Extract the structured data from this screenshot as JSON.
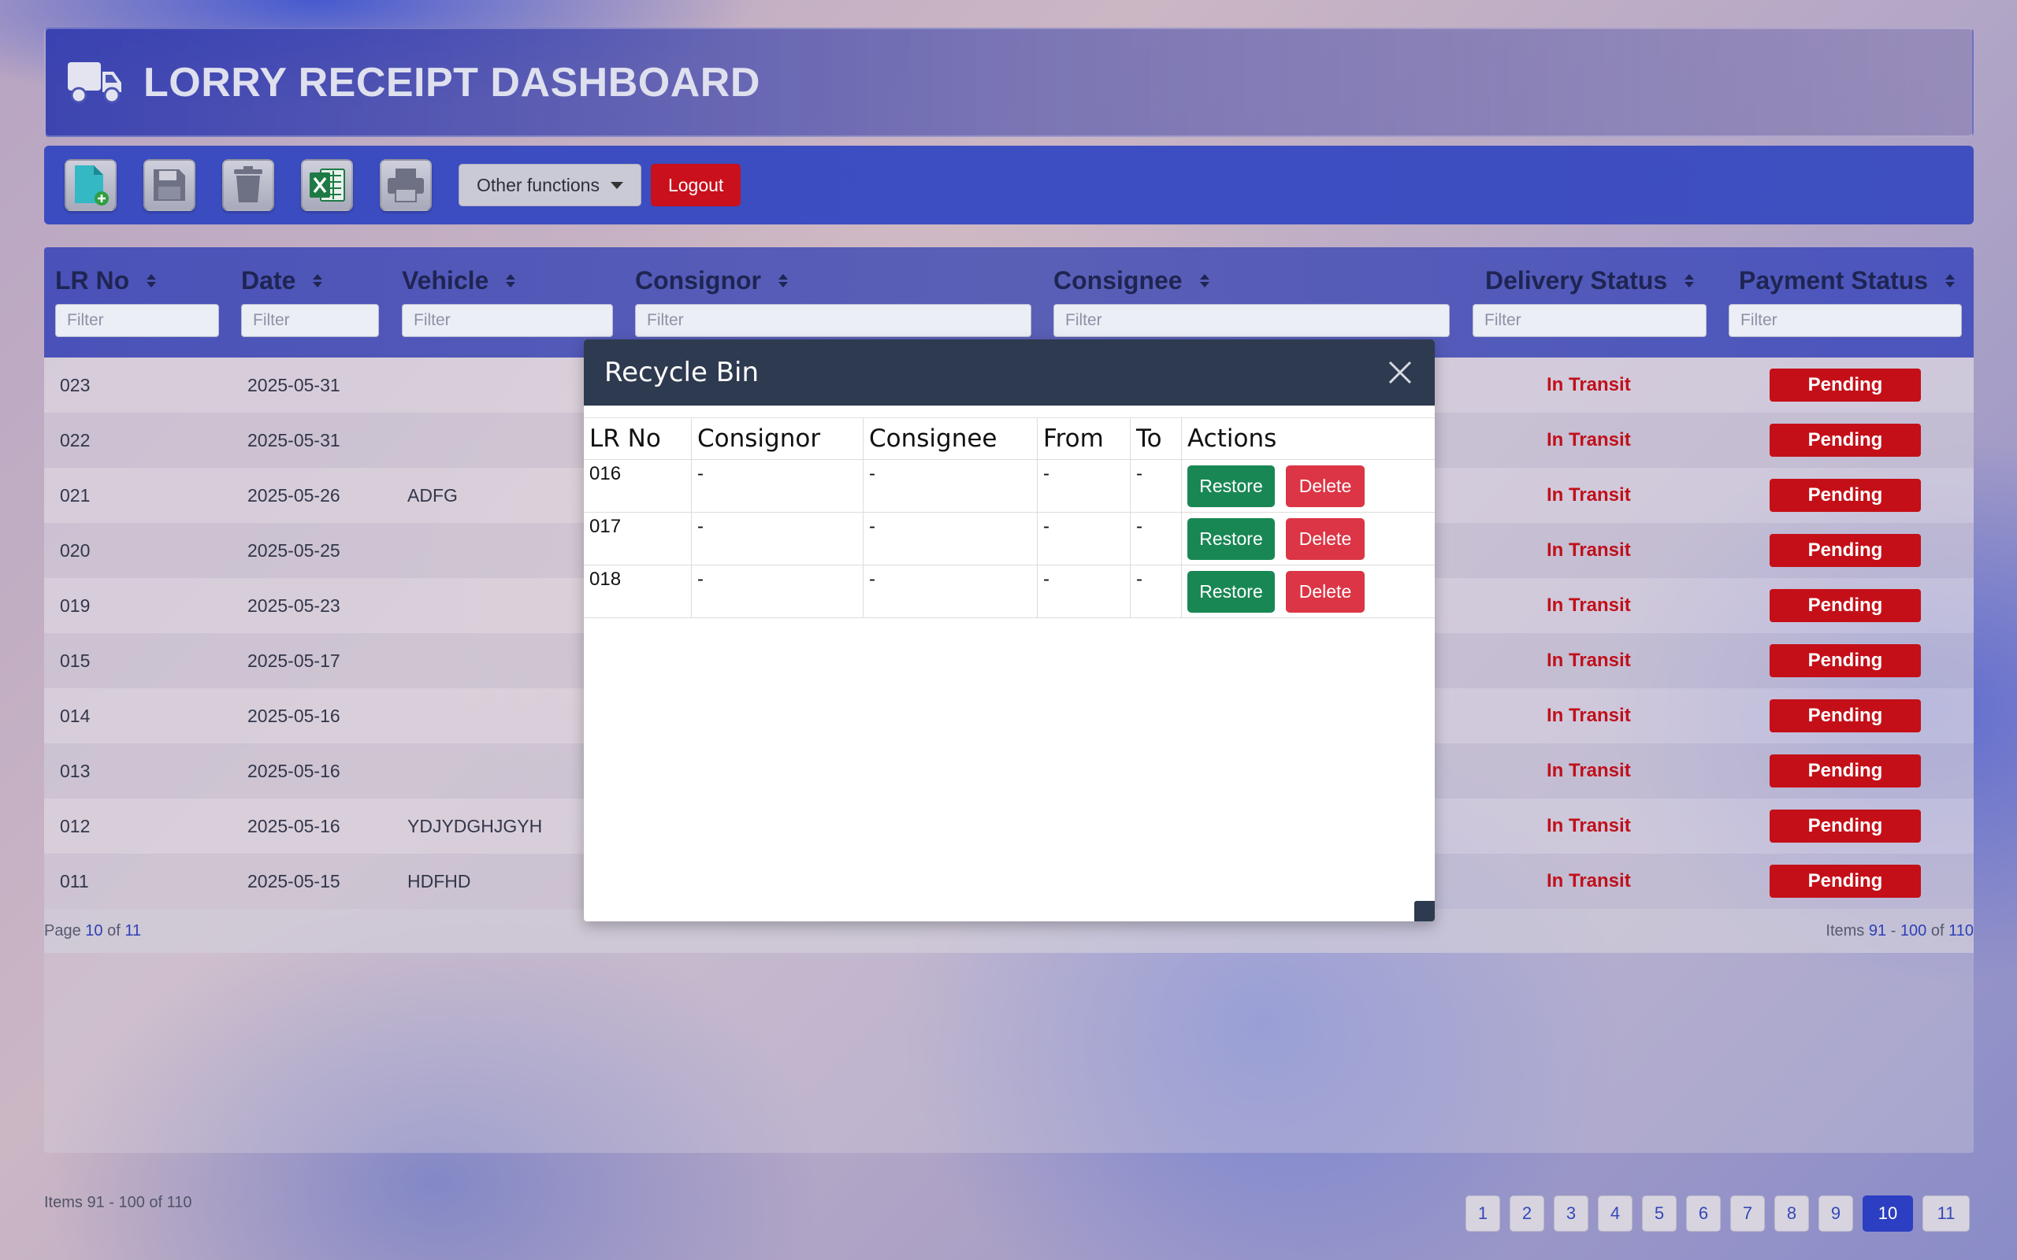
{
  "header": {
    "title": "LORRY RECEIPT DASHBOARD",
    "icon": "truck-icon"
  },
  "toolbar": {
    "buttons": [
      {
        "name": "new-document",
        "icon": "new-file-icon"
      },
      {
        "name": "save",
        "icon": "floppy-disk-icon"
      },
      {
        "name": "delete",
        "icon": "trash-icon"
      },
      {
        "name": "export-excel",
        "icon": "excel-icon"
      },
      {
        "name": "print",
        "icon": "printer-icon"
      }
    ],
    "other_functions_label": "Other functions",
    "logout_label": "Logout"
  },
  "grid": {
    "columns": [
      {
        "label": "LR No",
        "filter_placeholder": "Filter"
      },
      {
        "label": "Date",
        "filter_placeholder": "Filter"
      },
      {
        "label": "Vehicle",
        "filter_placeholder": "Filter"
      },
      {
        "label": "Consignor",
        "filter_placeholder": "Filter"
      },
      {
        "label": "Consignee",
        "filter_placeholder": "Filter"
      },
      {
        "label": "Delivery Status",
        "filter_placeholder": "Filter"
      },
      {
        "label": "Payment Status",
        "filter_placeholder": "Filter"
      }
    ],
    "rows": [
      {
        "lr_no": "023",
        "date": "2025-05-31",
        "vehicle": "",
        "delivery_status": "In Transit",
        "payment_status": "Pending"
      },
      {
        "lr_no": "022",
        "date": "2025-05-31",
        "vehicle": "",
        "delivery_status": "In Transit",
        "payment_status": "Pending"
      },
      {
        "lr_no": "021",
        "date": "2025-05-26",
        "vehicle": "ADFG",
        "delivery_status": "In Transit",
        "payment_status": "Pending"
      },
      {
        "lr_no": "020",
        "date": "2025-05-25",
        "vehicle": "",
        "delivery_status": "In Transit",
        "payment_status": "Pending"
      },
      {
        "lr_no": "019",
        "date": "2025-05-23",
        "vehicle": "",
        "delivery_status": "In Transit",
        "payment_status": "Pending"
      },
      {
        "lr_no": "015",
        "date": "2025-05-17",
        "vehicle": "",
        "delivery_status": "In Transit",
        "payment_status": "Pending"
      },
      {
        "lr_no": "014",
        "date": "2025-05-16",
        "vehicle": "",
        "delivery_status": "In Transit",
        "payment_status": "Pending"
      },
      {
        "lr_no": "013",
        "date": "2025-05-16",
        "vehicle": "",
        "delivery_status": "In Transit",
        "payment_status": "Pending"
      },
      {
        "lr_no": "012",
        "date": "2025-05-16",
        "vehicle": "YDJYDGHJGYH",
        "delivery_status": "In Transit",
        "payment_status": "Pending"
      },
      {
        "lr_no": "011",
        "date": "2025-05-15",
        "vehicle": "HDFHD",
        "delivery_status": "In Transit",
        "payment_status": "Pending"
      }
    ],
    "footer": {
      "page_prefix": "Page",
      "page_current": "10",
      "page_of": "of",
      "page_total": "11",
      "items_prefix": "Items",
      "items_from": "91",
      "items_dash": "-",
      "items_to": "100",
      "items_of": "of",
      "items_total": "110"
    }
  },
  "bottom_info": "Items 91 - 100 of 110",
  "pagination": {
    "pages": [
      "1",
      "2",
      "3",
      "4",
      "5",
      "6",
      "7",
      "8",
      "9",
      "10",
      "11"
    ],
    "active": "10"
  },
  "recycle_bin": {
    "title": "Recycle Bin",
    "columns": [
      "LR No",
      "Consignor",
      "Consignee",
      "From",
      "To",
      "Actions"
    ],
    "rows": [
      {
        "lr_no": "016",
        "consignor": "-",
        "consignee": "-",
        "from": "-",
        "to": "-"
      },
      {
        "lr_no": "017",
        "consignor": "-",
        "consignee": "-",
        "from": "-",
        "to": "-"
      },
      {
        "lr_no": "018",
        "consignor": "-",
        "consignee": "-",
        "from": "-",
        "to": "-"
      }
    ],
    "restore_label": "Restore",
    "delete_label": "Delete"
  },
  "colors": {
    "accent": "#3a4cbf",
    "danger": "#c50f18",
    "success": "#198754",
    "modal_header": "#2e3a4f"
  }
}
